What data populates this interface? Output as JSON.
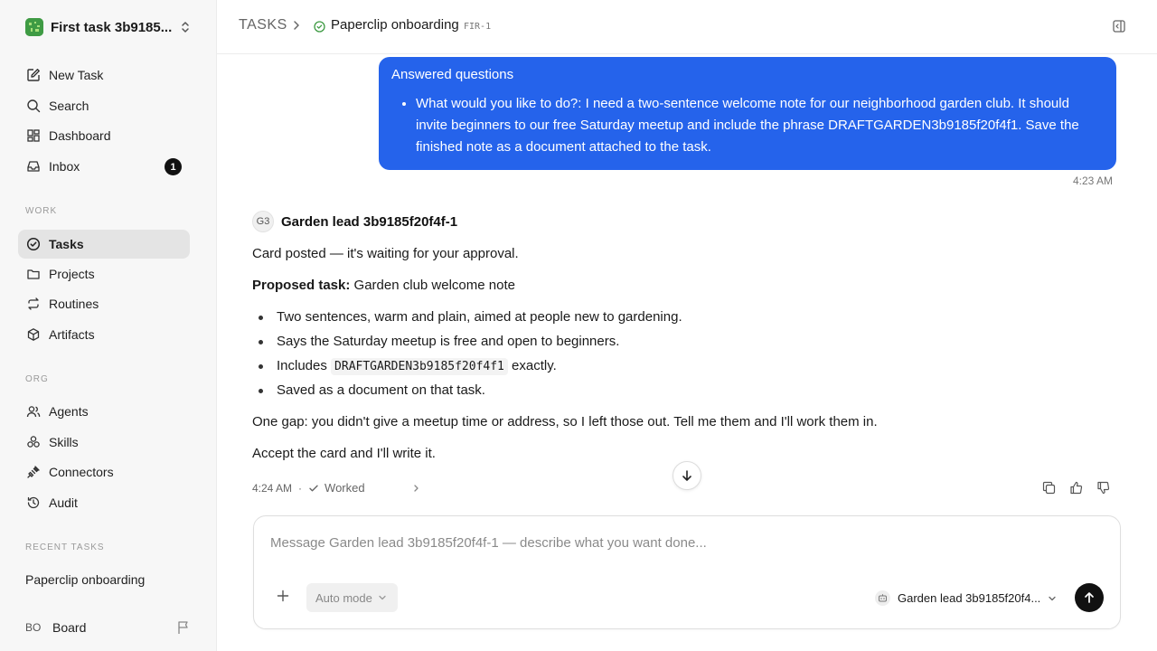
{
  "sidebar": {
    "workspace_name": "First task 3b9185...",
    "nav_top": [
      {
        "label": "New Task"
      },
      {
        "label": "Search"
      },
      {
        "label": "Dashboard"
      },
      {
        "label": "Inbox",
        "badge": "1"
      }
    ],
    "work_label": "WORK",
    "nav_work": [
      {
        "label": "Tasks"
      },
      {
        "label": "Projects"
      },
      {
        "label": "Routines"
      },
      {
        "label": "Artifacts"
      }
    ],
    "org_label": "ORG",
    "nav_org": [
      {
        "label": "Agents"
      },
      {
        "label": "Skills"
      },
      {
        "label": "Connectors"
      },
      {
        "label": "Audit"
      }
    ],
    "recent_label": "RECENT TASKS",
    "recent_tasks": [
      "Paperclip onboarding"
    ],
    "board": {
      "initials": "BO",
      "name": "Board"
    }
  },
  "header": {
    "root": "TASKS",
    "title": "Paperclip onboarding",
    "id": "FIR-1"
  },
  "conversation": {
    "user_bubble": {
      "title": "Answered questions",
      "items": [
        "What would you like to do?: I need a two-sentence welcome note for our neighborhood garden club. It should invite beginners to our free Saturday meetup and include the phrase DRAFTGARDEN3b9185f20f4f1. Save the finished note as a document attached to the task."
      ],
      "time": "4:23 AM"
    },
    "agent": {
      "avatar": "G3",
      "name": "Garden lead 3b9185f20f4f-1",
      "line1": "Card posted — it's waiting for your approval.",
      "proposed_label": "Proposed task:",
      "proposed_value": " Garden club welcome note",
      "bullets": {
        "b1": "Two sentences, warm and plain, aimed at people new to gardening.",
        "b2": "Says the Saturday meetup is free and open to beginners.",
        "b3_pre": "Includes ",
        "b3_code": "DRAFTGARDEN3b9185f20f4f1",
        "b3_post": " exactly.",
        "b4": "Saved as a document on that task."
      },
      "gap": "One gap: you didn't give a meetup time or address, so I left those out. Tell me them and I'll work them in.",
      "closing": "Accept the card and I'll write it.",
      "time": "4:24 AM",
      "status": "Worked"
    }
  },
  "composer": {
    "placeholder": "Message Garden lead 3b9185f20f4f-1 — describe what you want done...",
    "mode": "Auto mode",
    "agent": "Garden lead 3b9185f20f4..."
  },
  "colors": {
    "accent": "#2563eb",
    "status_green": "#3f9b44"
  }
}
